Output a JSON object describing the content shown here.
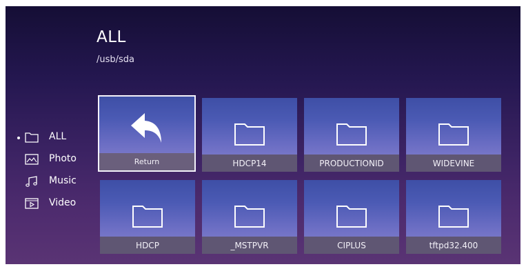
{
  "header": {
    "title": "ALL",
    "path": "/usb/sda"
  },
  "sidebar": {
    "items": [
      {
        "label": "ALL",
        "icon": "folder-icon",
        "active": true
      },
      {
        "label": "Photo",
        "icon": "photo-icon",
        "active": false
      },
      {
        "label": "Music",
        "icon": "music-icon",
        "active": false
      },
      {
        "label": "Video",
        "icon": "video-icon",
        "active": false
      }
    ]
  },
  "grid": {
    "items": [
      {
        "label": "Return",
        "icon": "return-arrow-icon",
        "selected": true
      },
      {
        "label": "HDCP14",
        "icon": "folder-icon"
      },
      {
        "label": "PRODUCTIONID",
        "icon": "folder-icon"
      },
      {
        "label": "WIDEVINE",
        "icon": "folder-icon"
      },
      {
        "label": "HDCP",
        "icon": "folder-icon"
      },
      {
        "label": "_MSTPVR",
        "icon": "folder-icon"
      },
      {
        "label": "CIPLUS",
        "icon": "folder-icon"
      },
      {
        "label": "tftpd32.400",
        "icon": "folder-icon"
      }
    ]
  },
  "colors": {
    "background_top": "#150e35",
    "background_bottom": "#5a3474",
    "tile": "#4b5ab4",
    "caption": "#5f5673"
  }
}
